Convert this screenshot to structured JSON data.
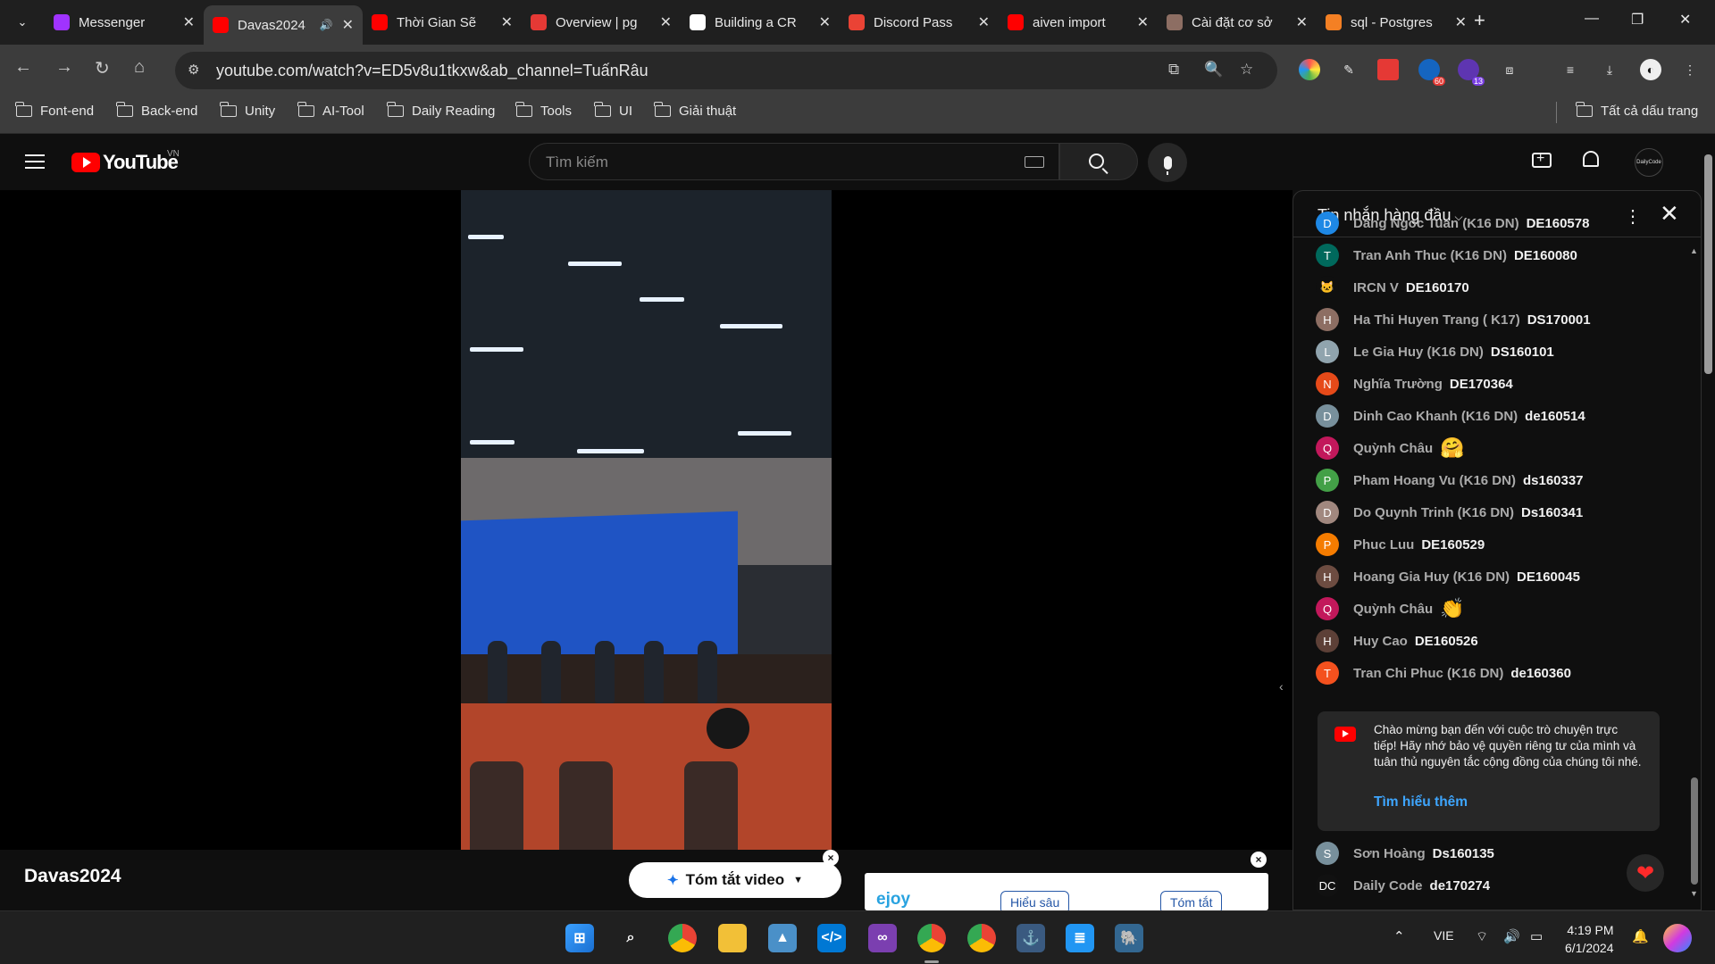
{
  "browser": {
    "tabs": [
      {
        "title": "Messenger",
        "favicon": "messenger-icon",
        "color": "#a033ff"
      },
      {
        "title": "Davas2024",
        "favicon": "youtube-icon",
        "color": "#ff0000",
        "active": true,
        "audio": true
      },
      {
        "title": "Thời Gian Sẽ",
        "favicon": "youtube-icon",
        "color": "#ff0000"
      },
      {
        "title": "Overview | pg",
        "favicon": "red-bug-icon",
        "color": "#e53935"
      },
      {
        "title": "Building a CR",
        "favicon": "medium-icon",
        "color": "#ffffff"
      },
      {
        "title": "Discord Pass",
        "favicon": "gmail-icon",
        "color": "#ea4335"
      },
      {
        "title": "aiven import",
        "favicon": "youtube-icon",
        "color": "#ff0000"
      },
      {
        "title": "Cài đặt cơ sở",
        "favicon": "avatar-favicon",
        "color": "#8d6e63"
      },
      {
        "title": "sql - Postgres",
        "favicon": "stackoverflow-icon",
        "color": "#f48024"
      }
    ],
    "url": "youtube.com/watch?v=ED5v8u1tkxw&ab_channel=TuấnRâu",
    "extension_badges": {
      "ext1": "60",
      "ext2": "13"
    },
    "bookmarks": [
      "Font-end",
      "Back-end",
      "Unity",
      "AI-Tool",
      "Daily Reading",
      "Tools",
      "UI",
      "Giải thuật"
    ],
    "all_bookmarks": "Tất cả dấu trang"
  },
  "youtube": {
    "logo_text": "YouTube",
    "country": "VN",
    "search_placeholder": "Tìm kiếm",
    "avatar_text": "DailyCode",
    "video_title": "Davas2024",
    "summary_button": "Tóm tắt video",
    "ejoy": {
      "logo": "ejoy",
      "btn1": "Hiểu sâu",
      "btn2": "Tóm tắt"
    }
  },
  "chat": {
    "title": "Tin nhắn hàng đầu",
    "messages": [
      {
        "initial": "D",
        "color": "#1e88e5",
        "author": "Dang Ngoc Tuan (K16 DN)",
        "text": "DE160578"
      },
      {
        "initial": "T",
        "color": "#00695c",
        "author": "Tran Anh Thuc (K16 DN)",
        "text": "DE160080"
      },
      {
        "initial": "🐱",
        "color": "#0f0f0f",
        "author": "IRCN V",
        "text": "DE160170"
      },
      {
        "initial": "H",
        "color": "#8d6e63",
        "author": "Ha Thi Huyen Trang ( K17)",
        "text": "DS170001"
      },
      {
        "initial": "L",
        "color": "#90a4ae",
        "author": "Le Gia Huy (K16 DN)",
        "text": "DS160101"
      },
      {
        "initial": "N",
        "color": "#e64a19",
        "author": "Nghĩa Trường",
        "text": "DE170364"
      },
      {
        "initial": "D",
        "color": "#78909c",
        "author": "Dinh Cao Khanh (K16 DN)",
        "text": "de160514"
      },
      {
        "initial": "Q",
        "color": "#c2185b",
        "author": "Quỳnh Châu",
        "text": "🤗"
      },
      {
        "initial": "P",
        "color": "#43a047",
        "author": "Pham Hoang Vu (K16 DN)",
        "text": "ds160337"
      },
      {
        "initial": "D",
        "color": "#a1887f",
        "author": "Do Quynh Trinh (K16 DN)",
        "text": "Ds160341"
      },
      {
        "initial": "P",
        "color": "#f57c00",
        "author": "Phuc Luu",
        "text": "DE160529"
      },
      {
        "initial": "H",
        "color": "#6d4c41",
        "author": "Hoang Gia Huy (K16 DN)",
        "text": "DE160045"
      },
      {
        "initial": "Q",
        "color": "#c2185b",
        "author": "Quỳnh Châu",
        "text": "👏"
      },
      {
        "initial": "H",
        "color": "#5d4037",
        "author": "Huy Cao",
        "text": "DE160526"
      },
      {
        "initial": "T",
        "color": "#f4511e",
        "author": "Tran Chi Phuc (K16 DN)",
        "text": "de160360"
      }
    ],
    "welcome_text": "Chào mừng bạn đến với cuộc trò chuyện trực tiếp! Hãy nhớ bảo vệ quyền riêng tư của mình và tuân thủ nguyên tắc cộng đồng của chúng tôi nhé.",
    "welcome_link": "Tìm hiểu thêm",
    "after_messages": [
      {
        "initial": "S",
        "color": "#78909c",
        "author": "Sơn Hoàng",
        "text": "Ds160135"
      },
      {
        "initial": "DC",
        "color": "#111111",
        "author": "Daily Code",
        "text": "de170274"
      }
    ]
  },
  "taskbar": {
    "apps": [
      "windows-start-icon",
      "search-icon",
      "chrome-icon",
      "file-explorer-icon",
      "photos-icon",
      "vscode-icon",
      "visual-studio-icon",
      "chrome-profile-icon",
      "chrome-profile-2-icon",
      "dbeaver-icon",
      "notepad-icon",
      "postgres-icon"
    ],
    "language": "VIE",
    "time": "4:19 PM",
    "date": "6/1/2024"
  }
}
